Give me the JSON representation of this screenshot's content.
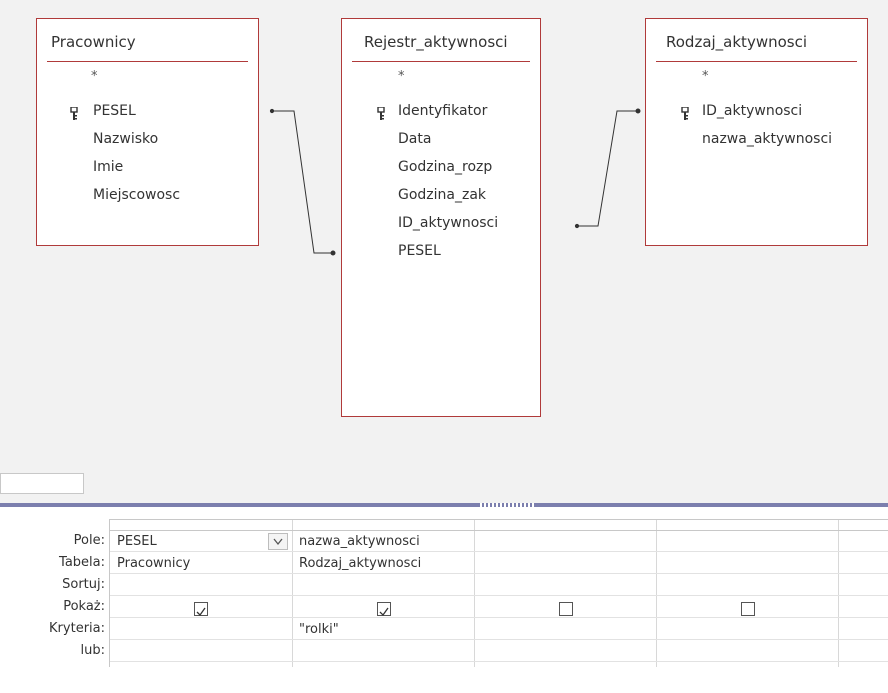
{
  "tables": [
    {
      "name": "Pracownicy",
      "all_fields": "*",
      "fields": [
        "PESEL",
        "Nazwisko",
        "Imie",
        "Miejscowosc"
      ],
      "key_field": "PESEL"
    },
    {
      "name": "Rejestr_aktywnosci",
      "all_fields": "*",
      "fields": [
        "Identyfikator",
        "Data",
        "Godzina_rozp",
        "Godzina_zak",
        "ID_aktywnosci",
        "PESEL"
      ],
      "key_field": "Identyfikator"
    },
    {
      "name": "Rodzaj_aktywnosci",
      "all_fields": "*",
      "fields": [
        "ID_aktywnosci",
        "nazwa_aktywnosci"
      ],
      "key_field": "ID_aktywnosci"
    }
  ],
  "relationships": [
    {
      "from": "Pracownicy.PESEL",
      "to": "Rejestr_aktywnosci.PESEL"
    },
    {
      "from": "Rejestr_aktywnosci.ID_aktywnosci",
      "to": "Rodzaj_aktywnosci.ID_aktywnosci"
    }
  ],
  "grid": {
    "row_labels": [
      "Pole:",
      "Tabela:",
      "Sortuj:",
      "Pokaż:",
      "Kryteria:",
      "lub:"
    ],
    "columns": [
      {
        "field": "PESEL",
        "table": "Pracownicy",
        "sort": "",
        "show": true,
        "criteria": "",
        "or": ""
      },
      {
        "field": "nazwa_aktywnosci",
        "table": "Rodzaj_aktywnosci",
        "sort": "",
        "show": true,
        "criteria": "\"rolki\"",
        "or": ""
      },
      {
        "field": "",
        "table": "",
        "sort": "",
        "show": false,
        "criteria": "",
        "or": ""
      },
      {
        "field": "",
        "table": "",
        "sort": "",
        "show": false,
        "criteria": "",
        "or": ""
      }
    ]
  },
  "colors": {
    "table_border": "#b03a3a",
    "splitter": "#7c7fae",
    "design_background": "#f2f2f2"
  }
}
